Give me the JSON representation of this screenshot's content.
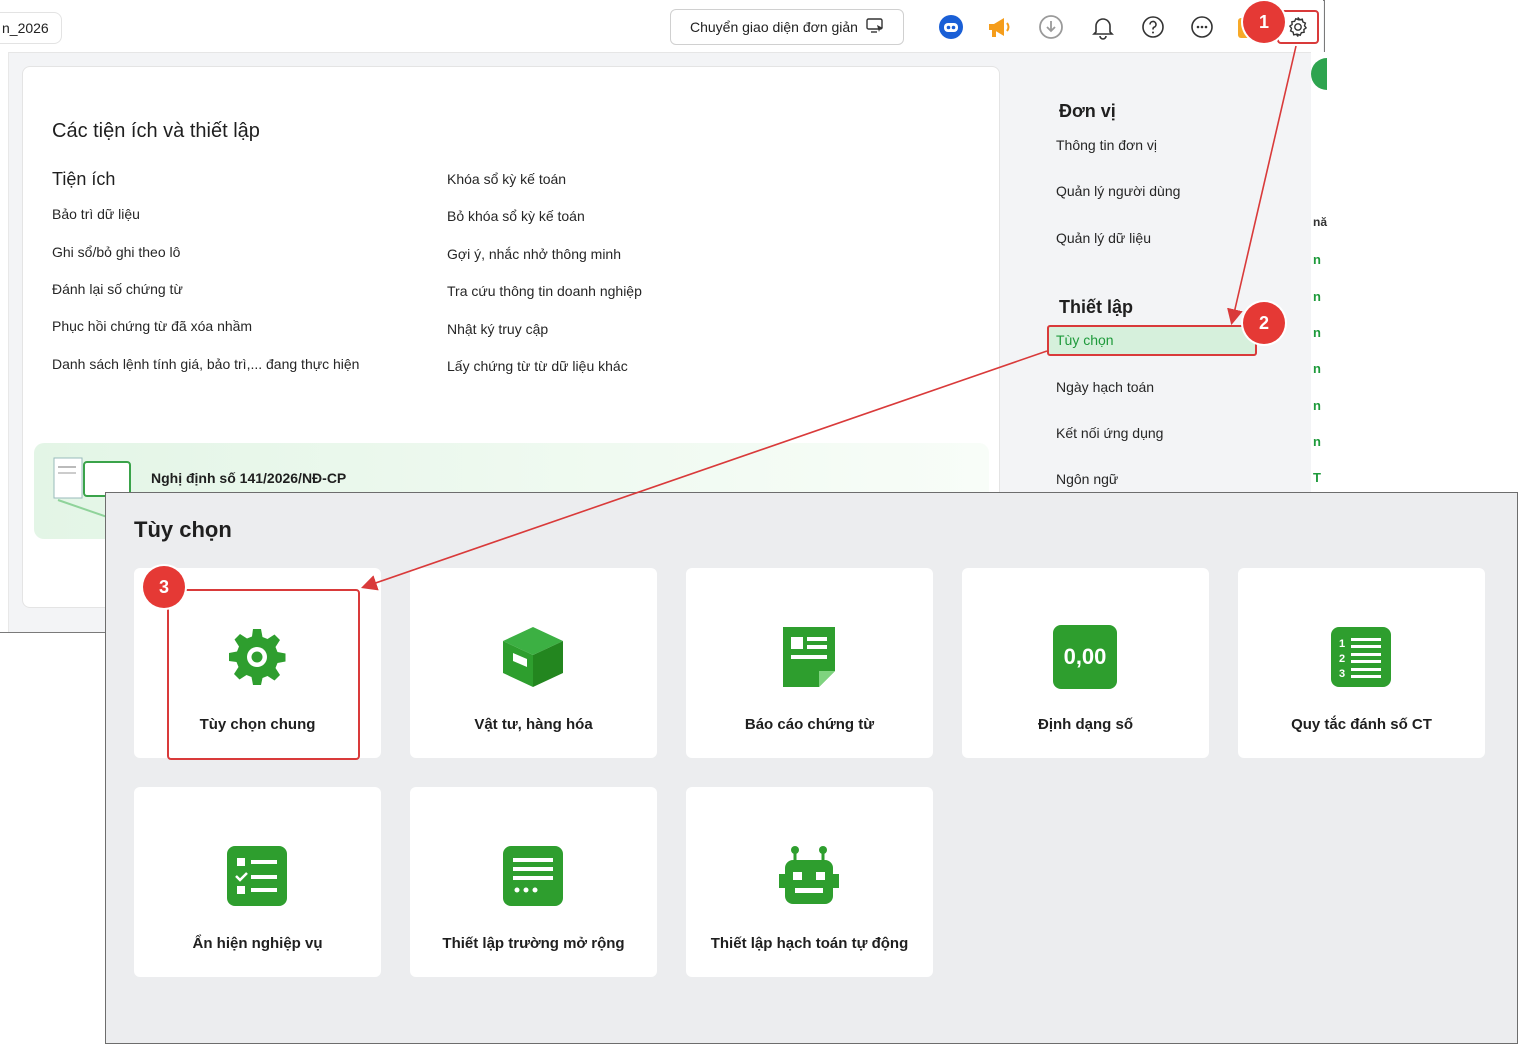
{
  "topbar": {
    "db_tab_label": "n_2026",
    "simple_ui_button": "Chuyển giao diện đơn giản",
    "icons": [
      "robot-assistant-icon",
      "megaphone-icon",
      "download-icon",
      "bell-icon",
      "help-icon",
      "more-icon",
      "settings-icon"
    ]
  },
  "utilities": {
    "title": "Các tiện ích và thiết lập",
    "section": "Tiện ích",
    "col1": [
      "Bảo trì dữ liệu",
      "Ghi sổ/bỏ ghi theo lô",
      "Đánh lại số chứng từ",
      "Phục hồi chứng từ đã xóa nhầm",
      "Danh sách lệnh tính giá, bảo trì,... đang thực hiện"
    ],
    "col2": [
      "Khóa sổ kỳ kế toán",
      "Bỏ khóa sổ kỳ kế toán",
      "Gợi ý, nhắc nhở thông minh",
      "Tra cứu thông tin doanh nghiệp",
      "Nhật ký truy cập",
      "Lấy chứng từ từ dữ liệu khác"
    ],
    "decree_banner": "Nghị định số 141/2026/NĐ-CP"
  },
  "sidebar": {
    "unit_heading": "Đơn vị",
    "unit_items": [
      "Thông tin đơn vị",
      "Quản lý người dùng",
      "Quản lý dữ liệu"
    ],
    "setup_heading": "Thiết lập",
    "setup_items": [
      "Tùy chọn",
      "Ngày hạch toán",
      "Kết nối ứng dụng",
      "Ngôn ngữ"
    ]
  },
  "edge_column": {
    "header": "nă",
    "cells": [
      "n",
      "n",
      "n",
      "n",
      "n",
      "n",
      "T"
    ]
  },
  "options": {
    "title": "Tùy chọn",
    "cards": [
      {
        "label": "Tùy chọn chung",
        "icon": "gear-icon"
      },
      {
        "label": "Vật tư, hàng hóa",
        "icon": "box-icon"
      },
      {
        "label": "Báo cáo chứng từ",
        "icon": "document-icon"
      },
      {
        "label": "Định dạng số",
        "icon": "number-format-icon",
        "icon_text": "0,00"
      },
      {
        "label": "Quy tắc đánh số CT",
        "icon": "numbered-list-icon"
      },
      {
        "label": "Ẩn hiện nghiệp vụ",
        "icon": "checklist-icon"
      },
      {
        "label": "Thiết lập trường mở rộng",
        "icon": "extended-fields-icon"
      },
      {
        "label": "Thiết lập hạch toán tự động",
        "icon": "robot-icon"
      }
    ]
  },
  "steps": [
    "1",
    "2",
    "3"
  ],
  "colors": {
    "accent_green": "#2e9e2e",
    "highlight_red": "#d93a3a",
    "badge_red": "#e53935",
    "selected_bg": "#d6f0dc"
  }
}
